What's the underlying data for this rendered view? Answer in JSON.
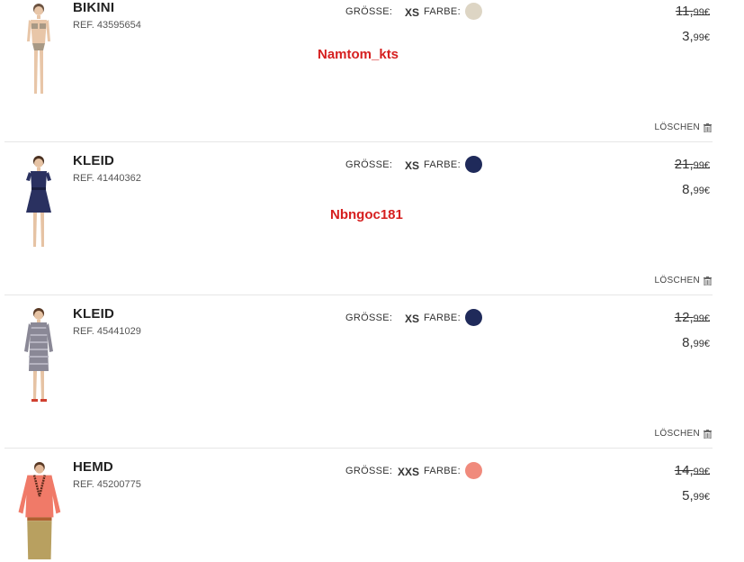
{
  "labels": {
    "size": "GRÖSSE:",
    "color": "FARBE:",
    "delete": "LÖSCHEN"
  },
  "items": [
    {
      "name": "BIKINI",
      "ref": "REF. 43595654",
      "size": "XS",
      "color_hex": "#ddd5c4",
      "old_price_main": "11,",
      "old_price_cents": "99€",
      "price_main": "3,",
      "price_cents": "99€"
    },
    {
      "name": "KLEID",
      "ref": "REF. 41440362",
      "size": "XS",
      "color_hex": "#1f2a5a",
      "old_price_main": "21,",
      "old_price_cents": "99€",
      "price_main": "8,",
      "price_cents": "99€"
    },
    {
      "name": "KLEID",
      "ref": "REF. 45441029",
      "size": "XS",
      "color_hex": "#1f2a5a",
      "old_price_main": "12,",
      "old_price_cents": "99€",
      "price_main": "8,",
      "price_cents": "99€"
    },
    {
      "name": "HEMD",
      "ref": "REF. 45200775",
      "size": "XXS",
      "color_hex": "#f08a7c",
      "old_price_main": "14,",
      "old_price_cents": "99€",
      "price_main": "5,",
      "price_cents": "99€"
    }
  ],
  "watermarks": [
    "Namtom_kts",
    "Nbngoc181"
  ]
}
